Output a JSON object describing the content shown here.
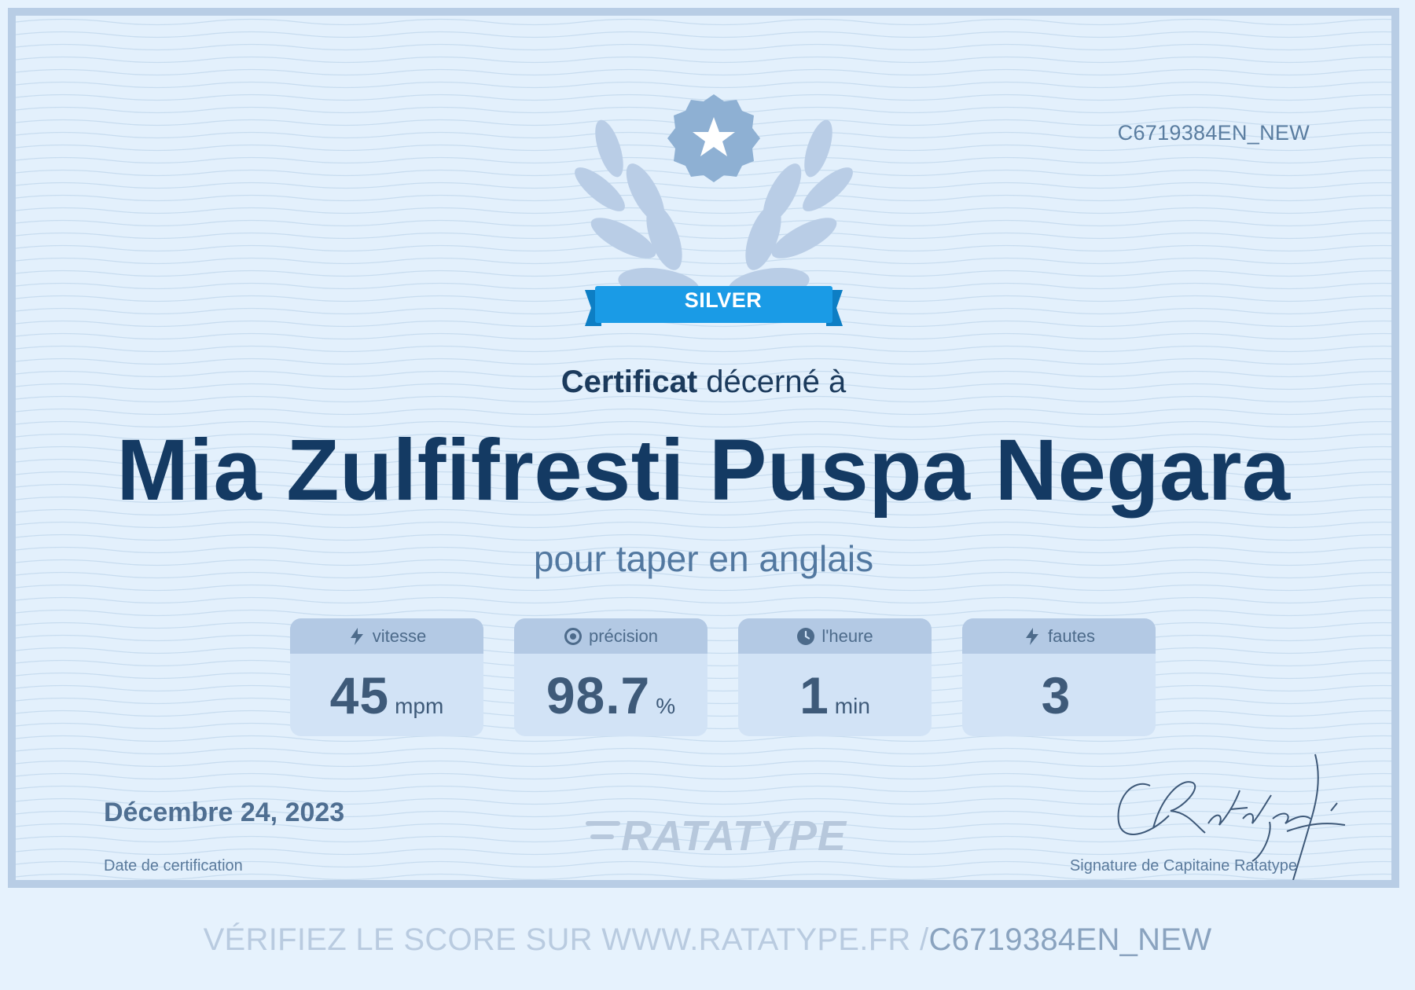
{
  "certificate": {
    "id": "C6719384EN_NEW",
    "badge": "SILVER",
    "awarded_bold": "Certificat",
    "awarded_rest": " décerné à",
    "recipient": "Mia Zulfifresti Puspa Negara",
    "subtitle": "pour taper en anglais",
    "date": "Décembre 24, 2023",
    "date_label": "Date de certification",
    "signature_label": "Signature de Capitaine Ratatype",
    "logo_text": "RATATYPE"
  },
  "stats": [
    {
      "label": "vitesse",
      "value": "45",
      "unit": "mpm",
      "icon": "lightning-icon"
    },
    {
      "label": "précision",
      "value": "98.7",
      "unit": "%",
      "icon": "target-icon"
    },
    {
      "label": "l'heure",
      "value": "1",
      "unit": "min",
      "icon": "clock-icon"
    },
    {
      "label": "fautes",
      "value": "3",
      "unit": "",
      "icon": "lightning-icon"
    }
  ],
  "footer": {
    "verify_prefix": "VÉRIFIEZ LE SCORE SUR WWW.RATATYPE.FR /",
    "verify_code": "C6719384EN_NEW"
  },
  "colors": {
    "page_background": "#e6f2fd",
    "frame_border": "#b8cde5",
    "name_text": "#143a63",
    "badge_ribbon": "#1a9be6",
    "emblem_star": "#8eb0d3"
  }
}
